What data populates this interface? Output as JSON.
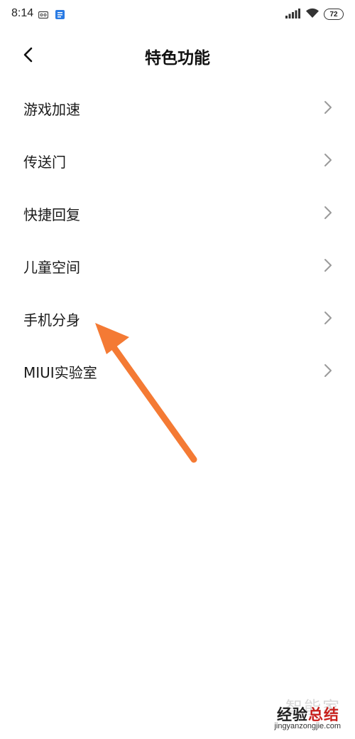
{
  "status_bar": {
    "time": "8:14",
    "left_icons": [
      "voicemail-icon",
      "app-notification-icon"
    ],
    "signal_icon": "signal-icon",
    "wifi_icon": "wifi-icon",
    "battery": "72"
  },
  "header": {
    "back_icon": "chevron-left-icon",
    "title": "特色功能"
  },
  "menu": {
    "items": [
      {
        "label": "游戏加速"
      },
      {
        "label": "传送门"
      },
      {
        "label": "快捷回复"
      },
      {
        "label": "儿童空间"
      },
      {
        "label": "手机分身"
      },
      {
        "label": "MIUI实验室"
      }
    ],
    "chevron_icon": "chevron-right-icon"
  },
  "annotation": {
    "arrow_color": "#f47a34",
    "points_to": "手机分身"
  },
  "watermark": {
    "line1": "智能家",
    "line2_a": "经验",
    "line2_b": "总结",
    "line3": "jingyanzongjie.com",
    "accent_color": "#c8201c"
  }
}
